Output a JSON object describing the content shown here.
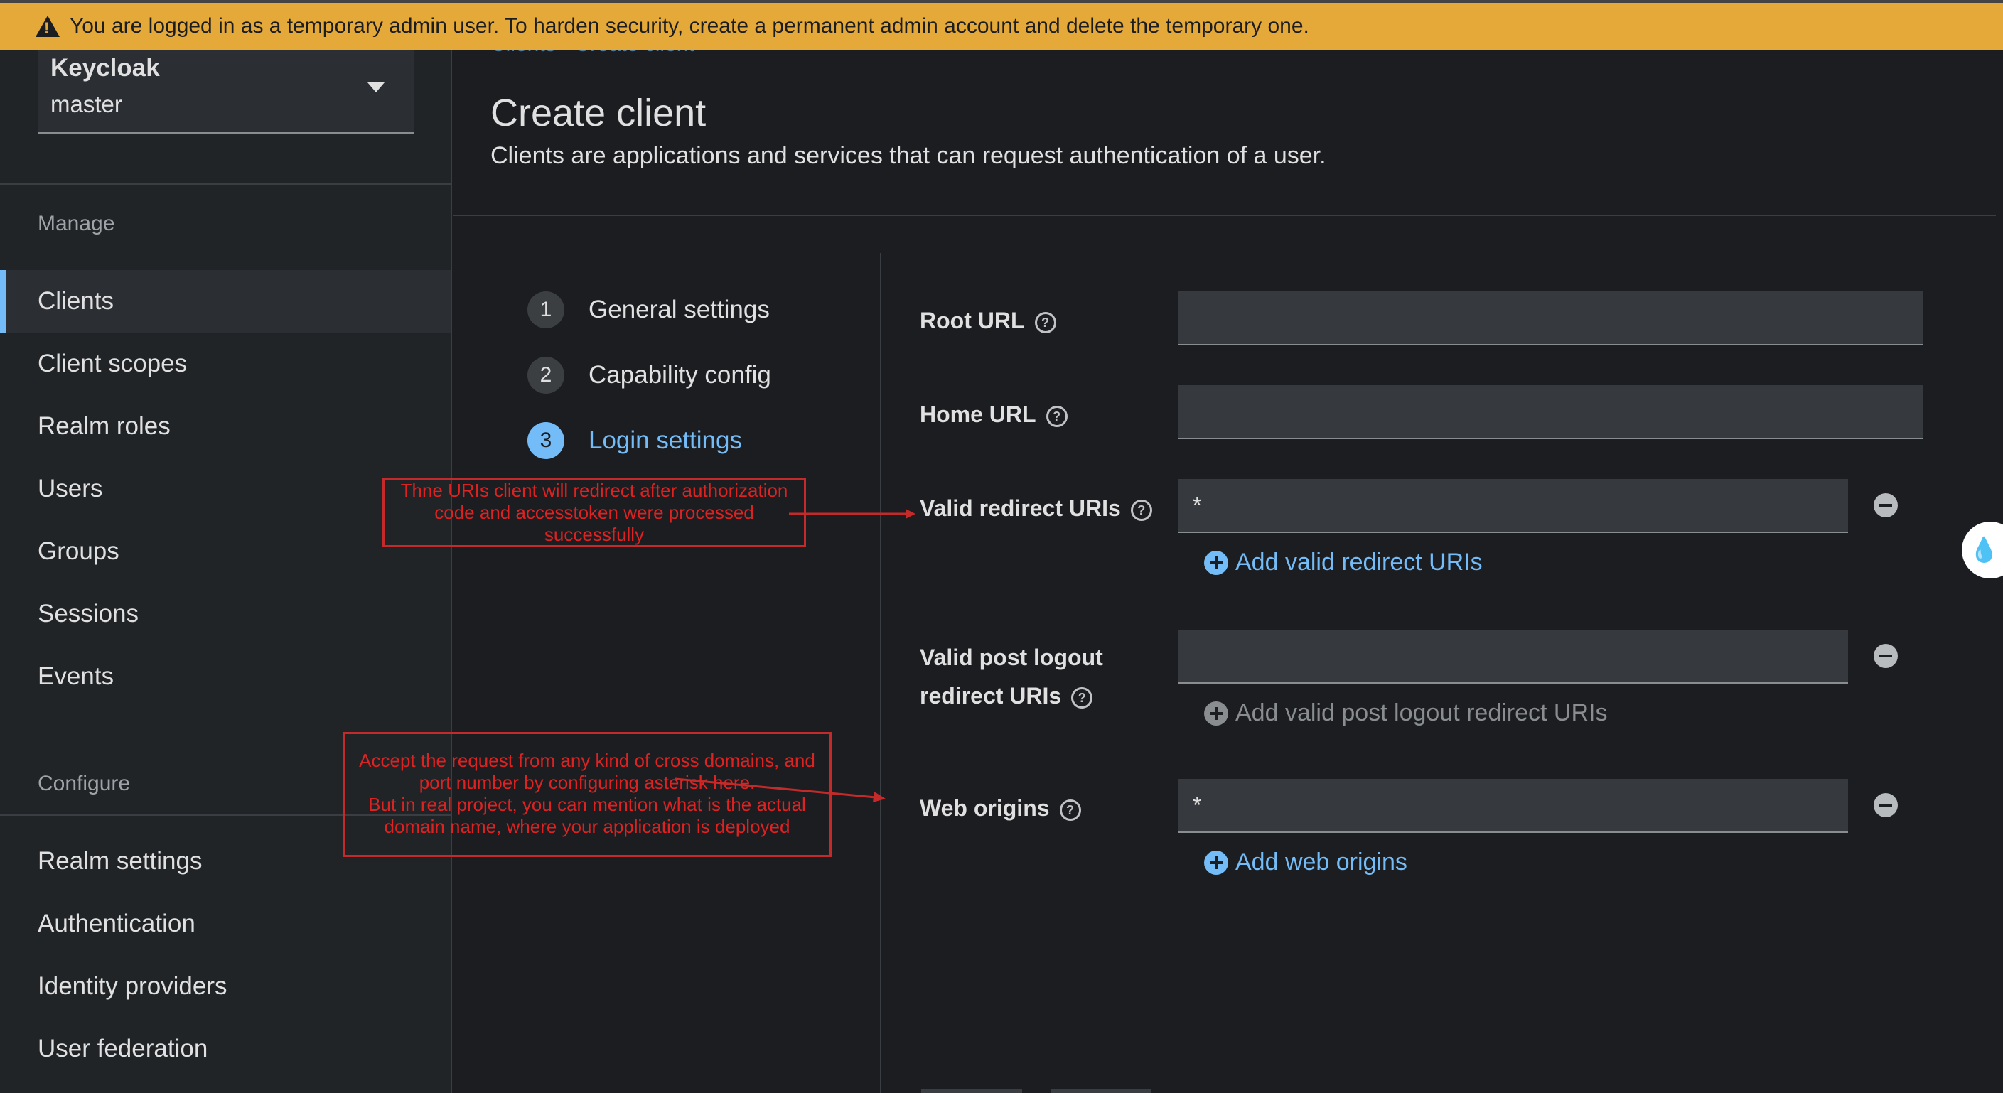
{
  "banner": {
    "icon": "warning-icon",
    "text": "You are logged in as a temporary admin user. To harden security, create a permanent admin account and delete the temporary one."
  },
  "sidebar": {
    "realm": {
      "name": "Keycloak",
      "value": "master"
    },
    "manage_title": "Manage",
    "manage_items": [
      "Clients",
      "Client scopes",
      "Realm roles",
      "Users",
      "Groups",
      "Sessions",
      "Events"
    ],
    "configure_title": "Configure",
    "configure_items": [
      "Realm settings",
      "Authentication",
      "Identity providers",
      "User federation"
    ],
    "active_item": "Clients"
  },
  "main": {
    "breadcrumb": "Clients  ›  Create client",
    "title": "Create client",
    "subtitle": "Clients are applications and services that can request authentication of a user.",
    "steps": [
      {
        "num": "1",
        "label": "General settings"
      },
      {
        "num": "2",
        "label": "Capability config"
      },
      {
        "num": "3",
        "label": "Login settings"
      }
    ],
    "current_step": 3
  },
  "form": {
    "root_url": {
      "label": "Root URL",
      "value": ""
    },
    "home_url": {
      "label": "Home URL",
      "value": ""
    },
    "valid_redirect": {
      "label": "Valid redirect URIs",
      "value": "*",
      "add_label": "Add valid redirect URIs"
    },
    "post_logout": {
      "label_line1": "Valid post logout",
      "label_line2": "redirect URIs",
      "value": "",
      "add_label": "Add valid post logout redirect URIs"
    },
    "web_origins": {
      "label": "Web origins",
      "value": "*",
      "add_label": "Add web origins"
    }
  },
  "annotations": {
    "redirect_note": "Thne URIs client will redirect after authorization code and accesstoken were processed successfully",
    "origins_note_1": "Accept the request from any kind of  cross domains, and port number by configuring asterisk here.",
    "origins_note_2": "But in real project, you can mention what is the actual domain name, where your application is deployed"
  },
  "colors": {
    "banner": "#e5a93a",
    "accent": "#73bcf7",
    "annotation": "#c42a2a"
  }
}
